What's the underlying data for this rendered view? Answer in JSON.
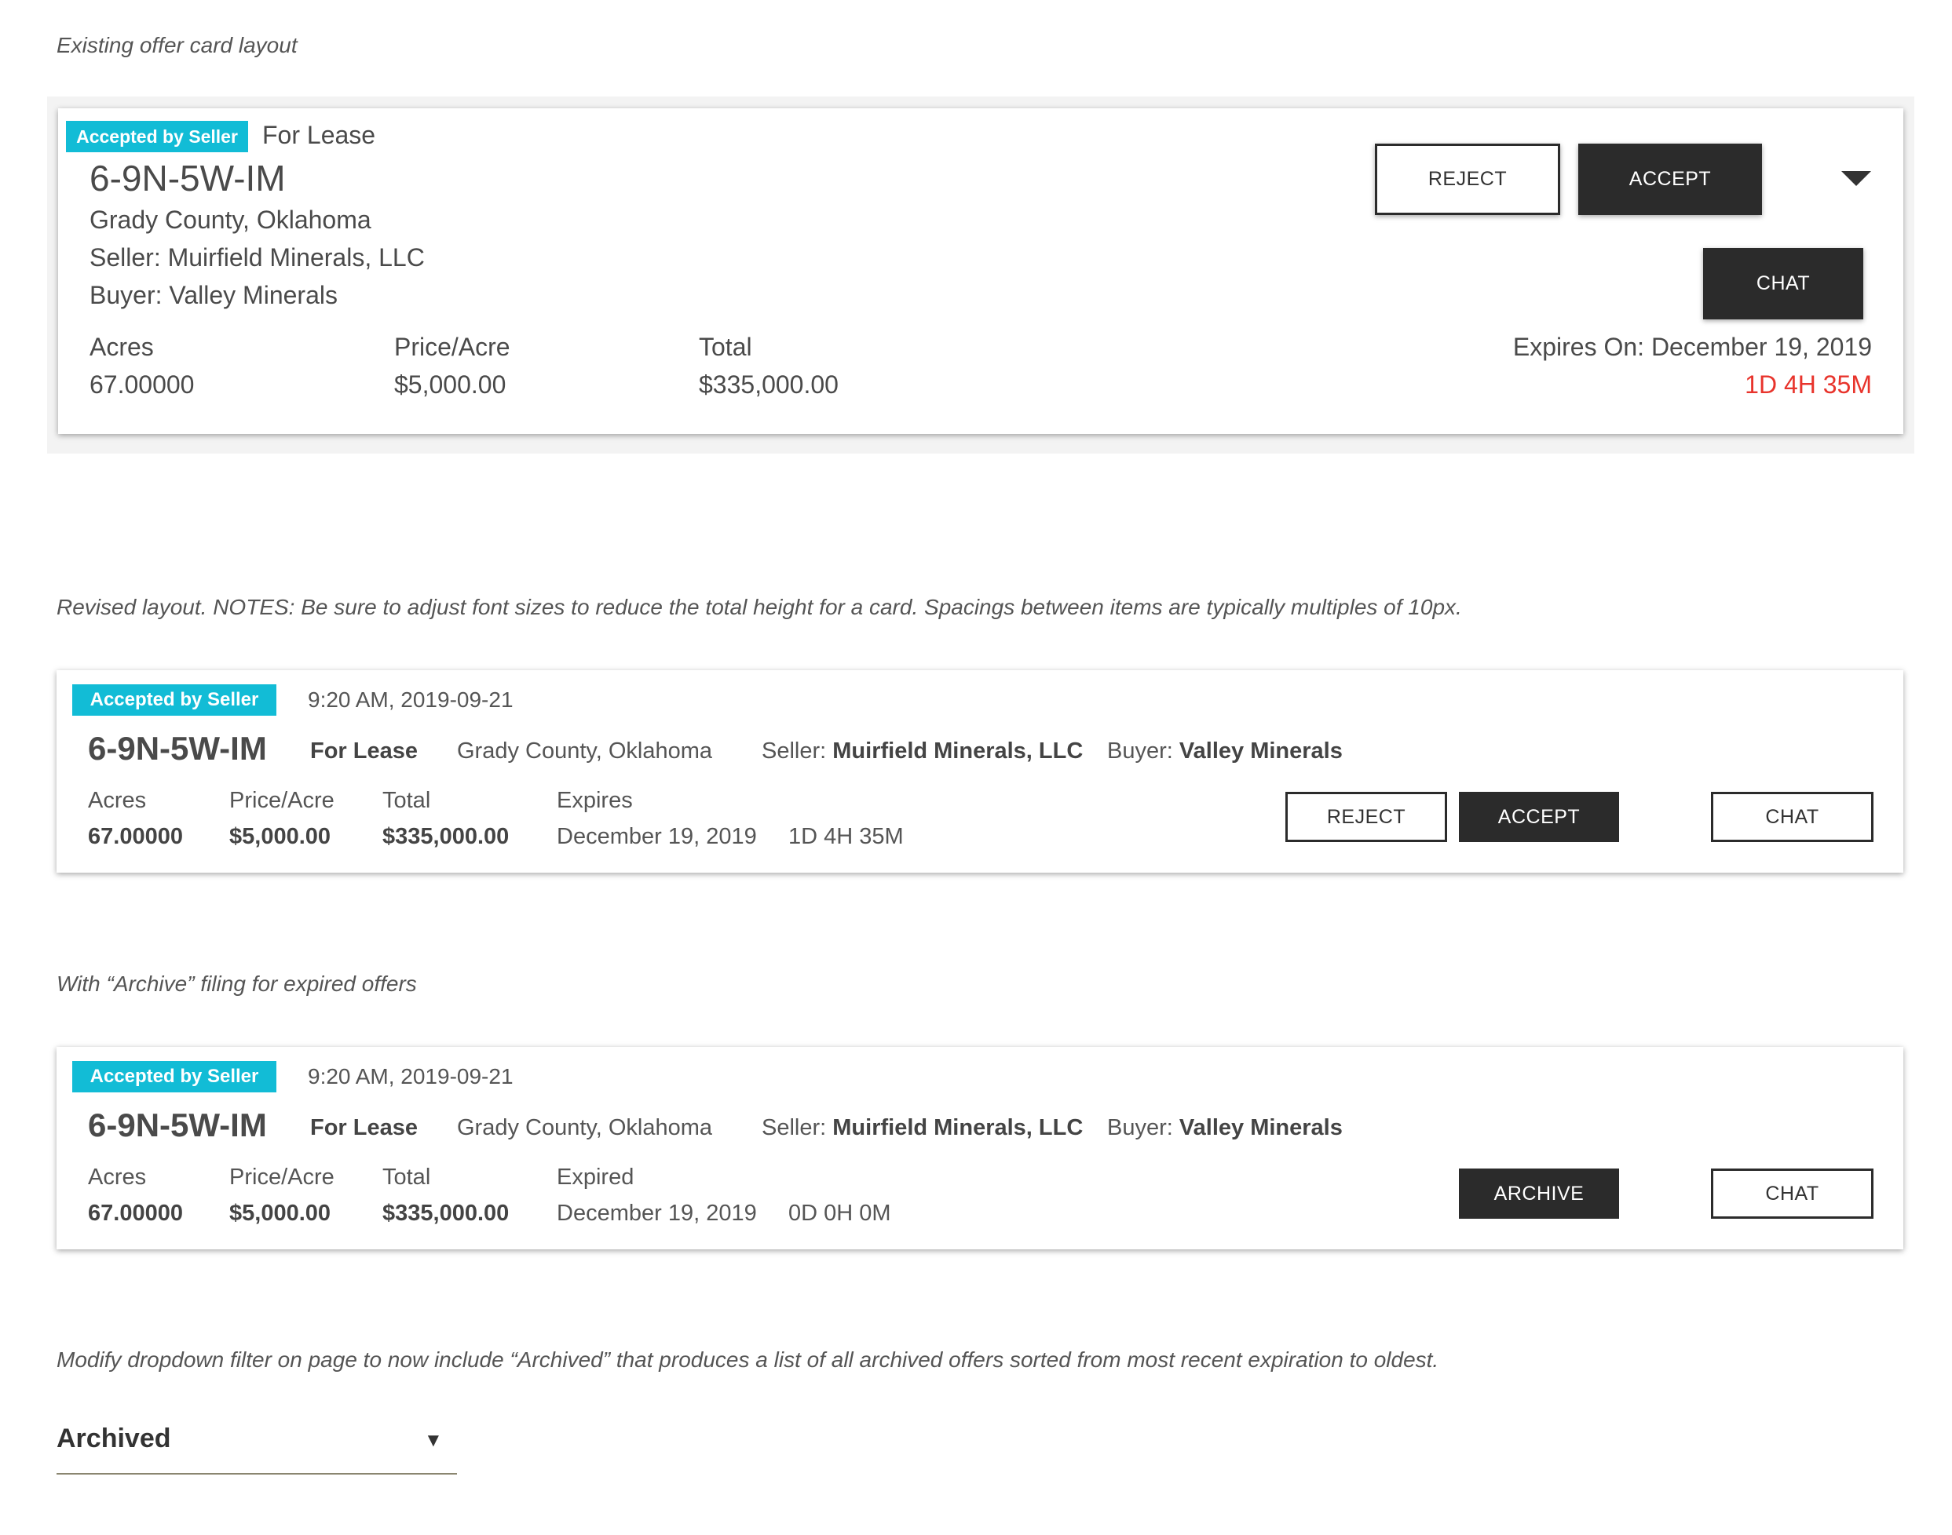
{
  "notes": {
    "existing": "Existing offer card layout",
    "revised": "Revised layout. NOTES: Be sure to adjust font sizes to reduce the total height for a card. Spacings between items are typically multiples of 10px.",
    "archive": "With “Archive” filing for expired offers",
    "dropdown": "Modify dropdown filter on page to now include “Archived” that produces a list of all archived offers sorted from most recent expiration to oldest."
  },
  "existing_card": {
    "badge": "Accepted by Seller",
    "type": "For Lease",
    "title": "6-9N-5W-IM",
    "county": "Grady County, Oklahoma",
    "seller": "Seller: Muirfield Minerals, LLC",
    "buyer": "Buyer: Valley Minerals",
    "acres_label": "Acres",
    "acres_value": "67.00000",
    "price_label": "Price/Acre",
    "price_value": "$5,000.00",
    "total_label": "Total",
    "total_value": "$335,000.00",
    "expires": "Expires On: December 19, 2019",
    "countdown": "1D 4H 35M",
    "reject": "REJECT",
    "accept": "ACCEPT",
    "chat": "CHAT",
    "expand_icon": "caret-down-icon"
  },
  "revised_card": {
    "badge": "Accepted by Seller",
    "time": "9:20 AM, 2019-09-21",
    "title": "6-9N-5W-IM",
    "type": "For Lease",
    "county": "Grady County, Oklahoma",
    "seller_label": "Seller:",
    "seller_value": "Muirfield Minerals, LLC",
    "buyer_label": "Buyer:",
    "buyer_value": "Valley Minerals",
    "acres_label": "Acres",
    "acres_value": "67.00000",
    "price_label": "Price/Acre",
    "price_value": "$5,000.00",
    "total_label": "Total",
    "total_value": "$335,000.00",
    "expires_label": "Expires",
    "expires_value": "December 19, 2019",
    "countdown": "1D 4H 35M",
    "reject": "REJECT",
    "accept": "ACCEPT",
    "chat": "CHAT"
  },
  "archive_card": {
    "badge": "Accepted by Seller",
    "time": "9:20 AM, 2019-09-21",
    "title": "6-9N-5W-IM",
    "type": "For Lease",
    "county": "Grady County, Oklahoma",
    "seller_label": "Seller:",
    "seller_value": "Muirfield Minerals, LLC",
    "buyer_label": "Buyer:",
    "buyer_value": "Valley Minerals",
    "acres_label": "Acres",
    "acres_value": "67.00000",
    "price_label": "Price/Acre",
    "price_value": "$5,000.00",
    "total_label": "Total",
    "total_value": "$335,000.00",
    "expires_label": "Expired",
    "expires_value": "December 19, 2019",
    "countdown": "0D 0H 0M",
    "archive": "ARCHIVE",
    "chat": "CHAT"
  },
  "filter_dropdown": {
    "selected": "Archived",
    "arrow": "▼"
  },
  "colors": {
    "badge": "#12bcd6",
    "countdown": "#e8342c",
    "dark_button": "#2b2b2b"
  }
}
